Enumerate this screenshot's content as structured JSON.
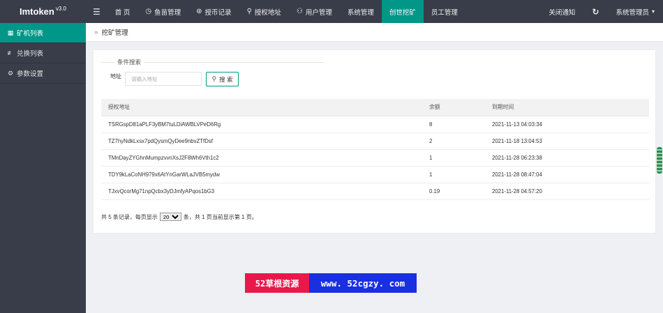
{
  "app": {
    "name": "Imtoken",
    "version": "v3.0"
  },
  "topnav": {
    "menu_icon": "menu-icon",
    "items": [
      {
        "label": "首 页",
        "icon": ""
      },
      {
        "label": "鱼苗管理",
        "icon": "clock-icon"
      },
      {
        "label": "授币记录",
        "icon": "coin-icon"
      },
      {
        "label": "授权地址",
        "icon": "location-pin-icon"
      },
      {
        "label": "用户管理",
        "icon": "user-icon"
      },
      {
        "label": "系统管理",
        "icon": ""
      },
      {
        "label": "创世挖矿",
        "icon": ""
      },
      {
        "label": "员工管理",
        "icon": ""
      }
    ],
    "active": "创世挖矿",
    "notify_label": "关闭通知",
    "refresh_icon": "refresh-icon",
    "admin_label": "系统管理员"
  },
  "sidebar": {
    "items": [
      {
        "label": "矿机列表",
        "icon": "grid-icon"
      },
      {
        "label": "兑换列表",
        "icon": "sliders-icon"
      },
      {
        "label": "参数设置",
        "icon": "gear-icon"
      }
    ],
    "active": "矿机列表"
  },
  "breadcrumb": {
    "label": "挖矿管理"
  },
  "search": {
    "legend": "条件搜索",
    "address_label": "地址",
    "address_placeholder": "请输入地址",
    "button_label": "搜 索"
  },
  "table": {
    "headers": [
      "授权地址",
      "余额",
      "到期时间"
    ],
    "rows": [
      [
        "TSRGspD81aPLF3yBM7tuLDiAWBLVPeD6Rg",
        "8",
        "2021-11-13 04:03:34"
      ],
      [
        "TZ7hyNdkLxsx7pdQysmQyDee9nbvZTfDsf",
        "2",
        "2021-11-18 13:04:53"
      ],
      [
        "TMnDayZYGhnMumpzvvnXsJ2F8Wh6Vth1c2",
        "1",
        "2021-11-28 06:23:38"
      ],
      [
        "TDY9kLaCoNH979x6AtYnGarWLaJVB5mydw",
        "1",
        "2021-11-28 08:47:04"
      ],
      [
        "TJxvQcorMg71npQcbx3yDJmfyAPqos1bG3",
        "0.19",
        "2021-11-28 04:57:20"
      ]
    ]
  },
  "pager": {
    "prefix": "共 5 条记录，每页显示",
    "page_size": "20",
    "suffix": "条，共 1 页当前显示第 1 页。"
  },
  "watermark": {
    "left": "52草根资源",
    "right": "www. 52cgzy. com"
  }
}
